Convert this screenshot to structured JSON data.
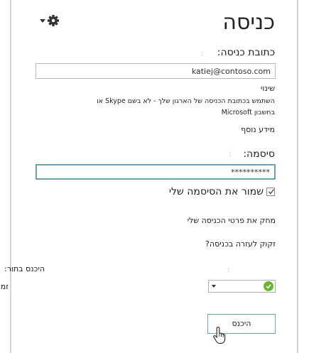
{
  "header": {
    "title": "כניסה",
    "settings_icon": "gear-icon",
    "menu_icon": "chevron-down-icon"
  },
  "signin_address": {
    "label": "כתובת כניסה:",
    "separator": ":",
    "value": "katiej@contoso.com"
  },
  "change": {
    "heading": "שינוי",
    "description_line1": "השתמש בכתובת הכניסה של הארגון שלך - לא בשם Skype או",
    "description_line2": "בחשבון Microsoft",
    "more_info": "מידע נוסף"
  },
  "password": {
    "label": "סיסמה:",
    "separator": ":",
    "value": "**********"
  },
  "remember": {
    "label": "שמור את הסיסמה שלי",
    "checked": true
  },
  "links": {
    "delete_info": "מחק את פרטי הכניסה שלי",
    "help": "זקוק לעזרה בכניסה?"
  },
  "status": {
    "label_outside": "היכנס בתור:",
    "separator": ":",
    "value_outside": "זמינות",
    "status_color": "#6ab52f"
  },
  "actions": {
    "signin_label": "היכנס"
  },
  "colors": {
    "focus_border": "#6ba1b8",
    "button_border": "#6aa7c4"
  }
}
